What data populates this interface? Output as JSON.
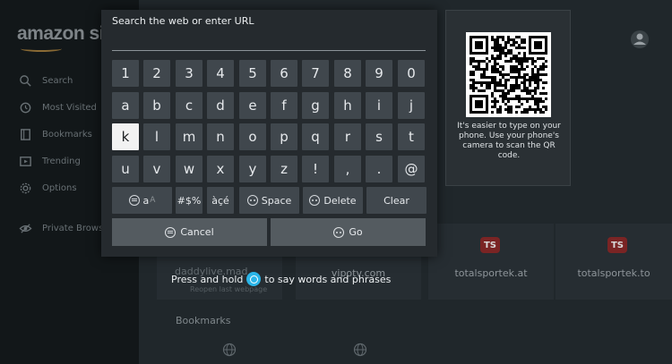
{
  "background": {
    "logo": "amazon si",
    "sidebar": [
      {
        "label": "Search",
        "icon": "search-icon"
      },
      {
        "label": "Most Visited",
        "icon": "history-icon"
      },
      {
        "label": "Bookmarks",
        "icon": "bookmark-icon"
      },
      {
        "label": "Trending",
        "icon": "trending-icon"
      },
      {
        "label": "Options",
        "icon": "gear-icon"
      },
      {
        "label": "Private Brows",
        "icon": "eye-slash-icon"
      }
    ],
    "tiles": [
      {
        "title": "daddylive.mad",
        "subtitle": "Reopen last webpage"
      },
      {
        "title": "vipotv.com"
      },
      {
        "title": "totalsportek.at",
        "badge": "TS"
      },
      {
        "title": "totalsportek.to",
        "badge": "TS"
      }
    ],
    "bookmarks_heading": "Bookmarks"
  },
  "keyboard": {
    "url_label": "Search the web or enter URL",
    "url_value": "",
    "rows": [
      [
        "1",
        "2",
        "3",
        "4",
        "5",
        "6",
        "7",
        "8",
        "9",
        "0"
      ],
      [
        "a",
        "b",
        "c",
        "d",
        "e",
        "f",
        "g",
        "h",
        "i",
        "j"
      ],
      [
        "k",
        "l",
        "m",
        "n",
        "o",
        "p",
        "q",
        "r",
        "s",
        "t"
      ],
      [
        "u",
        "v",
        "w",
        "x",
        "y",
        "z",
        "!",
        ",",
        ".",
        "@"
      ]
    ],
    "active_key": "k",
    "function_keys": {
      "case_label": "aA",
      "case_main": "a",
      "case_alt": "A",
      "symbols": "#$%",
      "accents": "àçé",
      "space": "Space",
      "delete": "Delete",
      "clear": "Clear"
    },
    "cancel_label": "Cancel",
    "go_label": "Go"
  },
  "qr": {
    "hint": "It's easier to type on your phone. Use your phone's camera to scan the QR code."
  },
  "voice_hint": {
    "before": "Press and hold",
    "after": "to say words and phrases"
  }
}
